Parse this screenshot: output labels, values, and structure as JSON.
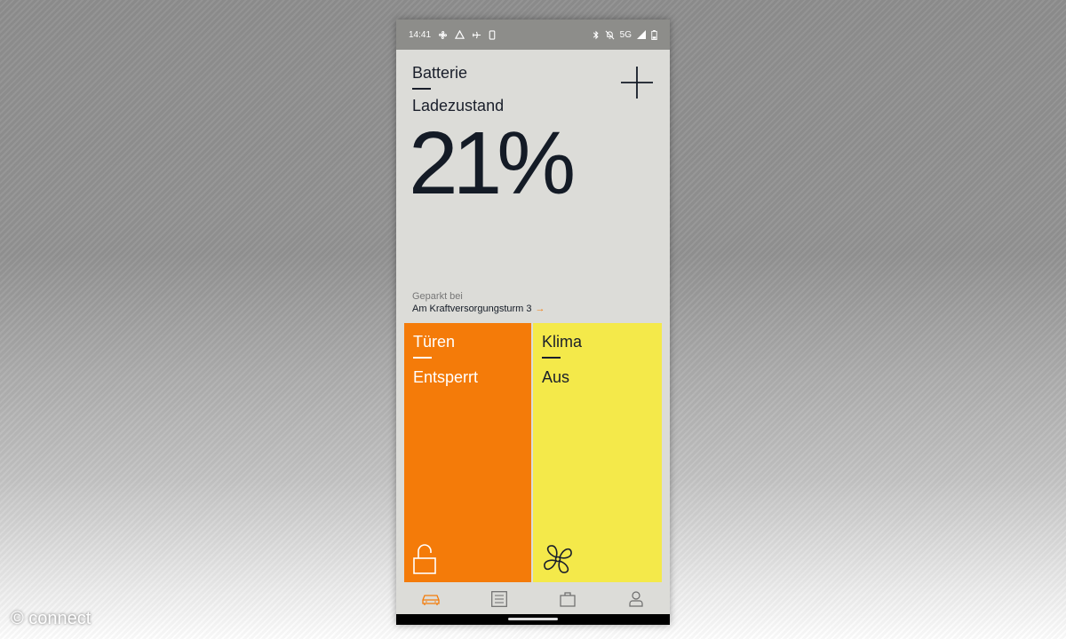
{
  "status_bar": {
    "time": "14:41",
    "network": "5G",
    "icons_left": [
      "fan-icon",
      "recycle-icon",
      "airplane-icon",
      "phone-icon"
    ],
    "icons_right": [
      "bluetooth-icon",
      "muted-bell-icon",
      "signal-icon",
      "battery-icon"
    ]
  },
  "battery": {
    "title": "Batterie",
    "subtitle": "Ladezustand",
    "charge": "21%"
  },
  "parked": {
    "label": "Geparkt bei",
    "address": "Am Kraftversorgungsturm 3",
    "arrow": "→"
  },
  "tiles": {
    "doors": {
      "title": "Türen",
      "value": "Entsperrt",
      "icon": "unlocked-padlock-icon",
      "color": "#f47b09"
    },
    "climate": {
      "title": "Klima",
      "value": "Aus",
      "icon": "fan-icon",
      "color": "#f4e94a"
    }
  },
  "nav": [
    {
      "name": "car",
      "icon": "car-icon",
      "active": true
    },
    {
      "name": "list",
      "icon": "list-icon",
      "active": false
    },
    {
      "name": "shop",
      "icon": "bag-icon",
      "active": false
    },
    {
      "name": "profile",
      "icon": "person-icon",
      "active": false
    }
  ],
  "colors": {
    "accent": "#f47b09",
    "text": "#141b26"
  },
  "watermark": "© connect"
}
